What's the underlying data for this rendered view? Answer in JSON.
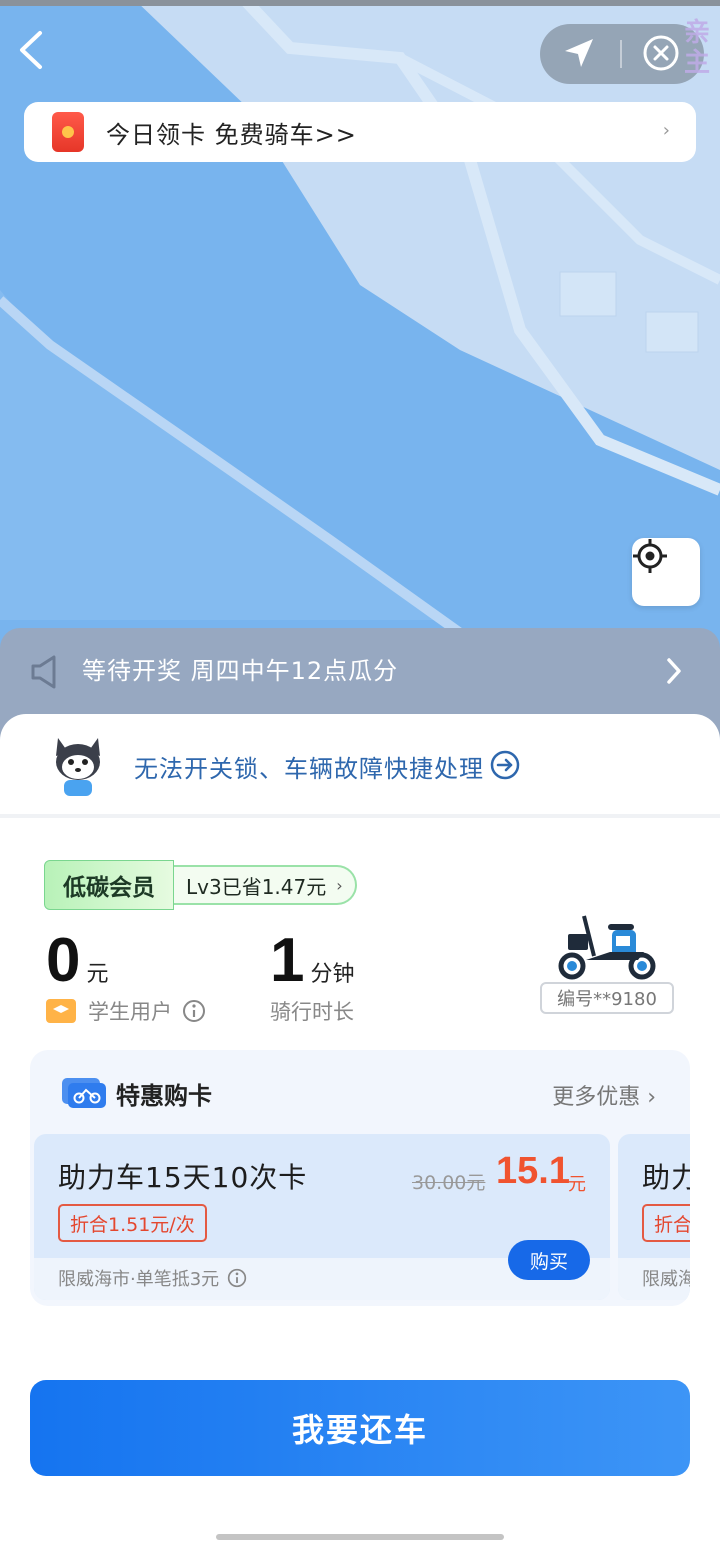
{
  "map": {
    "side_text": "亲\n主"
  },
  "promo": {
    "text": "今日领卡 免费骑车>>",
    "chevron": "›"
  },
  "notice": {
    "text": "等待开奖 周四中午12点瓜分"
  },
  "help": {
    "text": "无法开关锁、车辆故障快捷处理"
  },
  "member": {
    "tag": "低碳会员",
    "level": "Lv3已省1.47元",
    "chevron": "›"
  },
  "ride": {
    "fee_value": "0",
    "fee_unit": "元",
    "fee_label": "学生用户",
    "duration_value": "1",
    "duration_unit": "分钟",
    "duration_label": "骑行时长",
    "bike_id": "编号**9180"
  },
  "offers": {
    "title": "特惠购卡",
    "more": "更多优惠 ›",
    "cards": [
      {
        "name": "助力车15天10次卡",
        "per_ride": "折合1.51元/次",
        "original_price": "30.00元",
        "price": "15.1",
        "price_unit": "元",
        "footnote": "限威海市·单笔抵3元",
        "buy_label": "购买"
      },
      {
        "name": "助力",
        "per_ride": "折合",
        "footnote": "限威海"
      }
    ]
  },
  "action": {
    "return_label": "我要还车"
  },
  "icons": {
    "back": "chevron-left-icon",
    "navigate": "navigation-arrow-icon",
    "close": "close-circle-icon",
    "locate": "locate-crosshair-icon",
    "speaker": "speaker-icon",
    "arrow": "arrow-right-circle-icon"
  },
  "colors": {
    "primary": "#1769e8",
    "price": "#f0532f",
    "map_water": "#78b4ee",
    "map_land": "#c6dcf4"
  }
}
